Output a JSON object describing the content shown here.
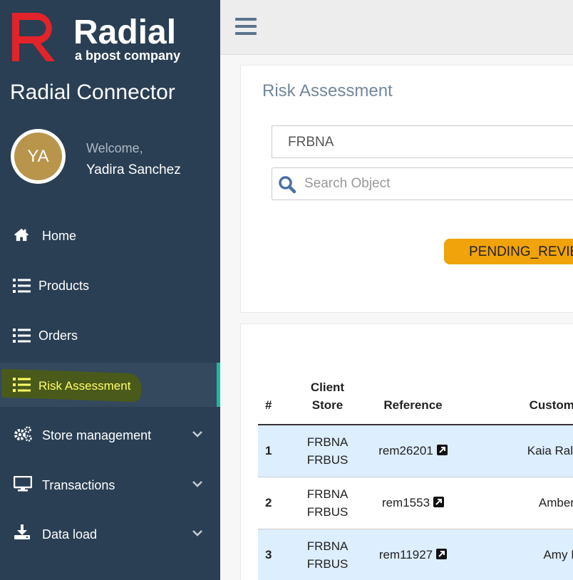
{
  "brand": {
    "logo_word": "Radial",
    "logo_tagline": "a bpost company",
    "app_title": "Radial Connector",
    "brand_red": "#e2232a"
  },
  "user": {
    "initials": "YA",
    "welcome": "Welcome,",
    "name": "Yadira Sanchez"
  },
  "nav": {
    "items": [
      {
        "label": "Home",
        "icon": "home-icon"
      },
      {
        "label": "Products",
        "icon": "list-icon"
      },
      {
        "label": "Orders",
        "icon": "list-icon"
      },
      {
        "label": "Risk Assessment",
        "icon": "list-icon",
        "active": true
      },
      {
        "label": "Store management",
        "icon": "gears-icon",
        "expandable": true
      },
      {
        "label": "Transactions",
        "icon": "monitor-icon",
        "expandable": true
      },
      {
        "label": "Data load",
        "icon": "download-icon",
        "expandable": true
      }
    ]
  },
  "page": {
    "title": "Risk Assessment",
    "store_select_value": "FRBNA",
    "search_placeholder": "Search Object",
    "status_filter": "PENDING_REVIE"
  },
  "table": {
    "headers": {
      "num": "#",
      "client_store_line1": "Client",
      "client_store_line2": "Store",
      "reference": "Reference",
      "customer": "Customer"
    },
    "rows": [
      {
        "num": "1",
        "store1": "FRBNA",
        "store2": "FRBUS",
        "reference": "rem26201",
        "customer": "Kaia Raley"
      },
      {
        "num": "2",
        "store1": "FRBNA",
        "store2": "FRBUS",
        "reference": "rem1553",
        "customer": "Amber B"
      },
      {
        "num": "3",
        "store1": "FRBNA",
        "store2": "FRBUS",
        "reference": "rem11927",
        "customer": "Amy Bu"
      }
    ]
  },
  "colors": {
    "sidebar_bg": "#2a3f54",
    "active_accent": "#1abb9c",
    "status_pill": "#f0a30a",
    "row_stripe": "#ddeeff"
  }
}
